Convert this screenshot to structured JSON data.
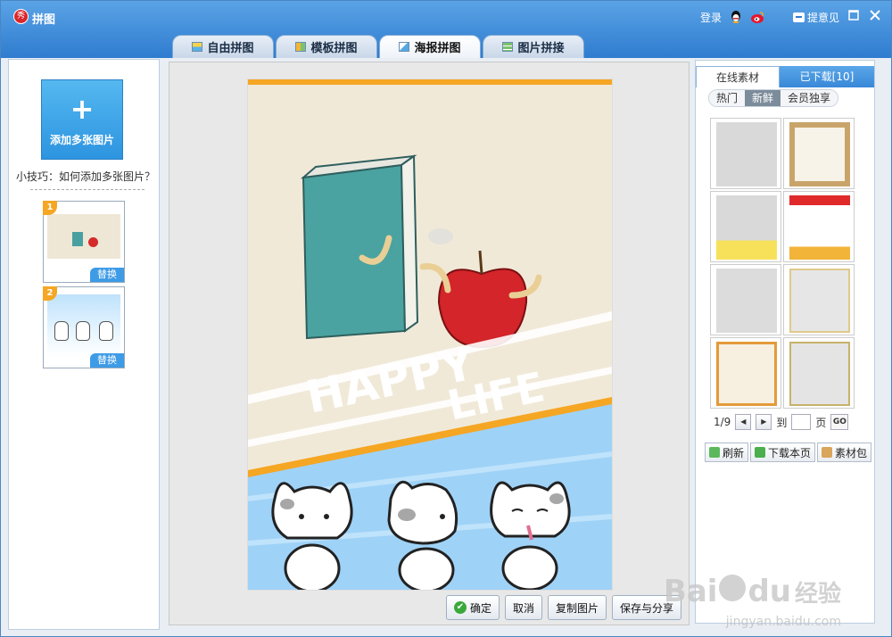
{
  "window": {
    "title": "拼图",
    "login": "登录",
    "feedback": "提意见"
  },
  "tabs": [
    {
      "label": "自由拼图",
      "active": false
    },
    {
      "label": "模板拼图",
      "active": false
    },
    {
      "label": "海报拼图",
      "active": true
    },
    {
      "label": "图片拼接",
      "active": false
    }
  ],
  "left": {
    "add_plus": "+",
    "add_label": "添加多张图片",
    "tip": "小技巧：如何添加多张图片？",
    "thumbs": [
      {
        "num": "1",
        "replace": "替换"
      },
      {
        "num": "2",
        "replace": "替换"
      }
    ]
  },
  "canvas": {
    "poster_text_1": "HAPPY",
    "poster_text_2": "LIFE",
    "accent": "#f5a623",
    "band_color": "#9fd2f7"
  },
  "actions": {
    "ok": "确定",
    "cancel": "取消",
    "copy": "复制图片",
    "save_share": "保存与分享"
  },
  "right": {
    "tab_online": "在线素材",
    "tab_downloaded": "已下载[10]",
    "filters": [
      "热门",
      "新鲜",
      "会员独享"
    ],
    "active_filter": "新鲜",
    "pager": {
      "page": "1/9",
      "goto_label": "到",
      "page_unit": "页",
      "go": "GO"
    },
    "buttons": {
      "refresh": "刷新",
      "download_page": "下载本页",
      "pack": "素材包"
    }
  },
  "watermark": {
    "brand_a": "Bai",
    "brand_b": "du",
    "brand_c": "经验",
    "url": "jingyan.baidu.com"
  }
}
